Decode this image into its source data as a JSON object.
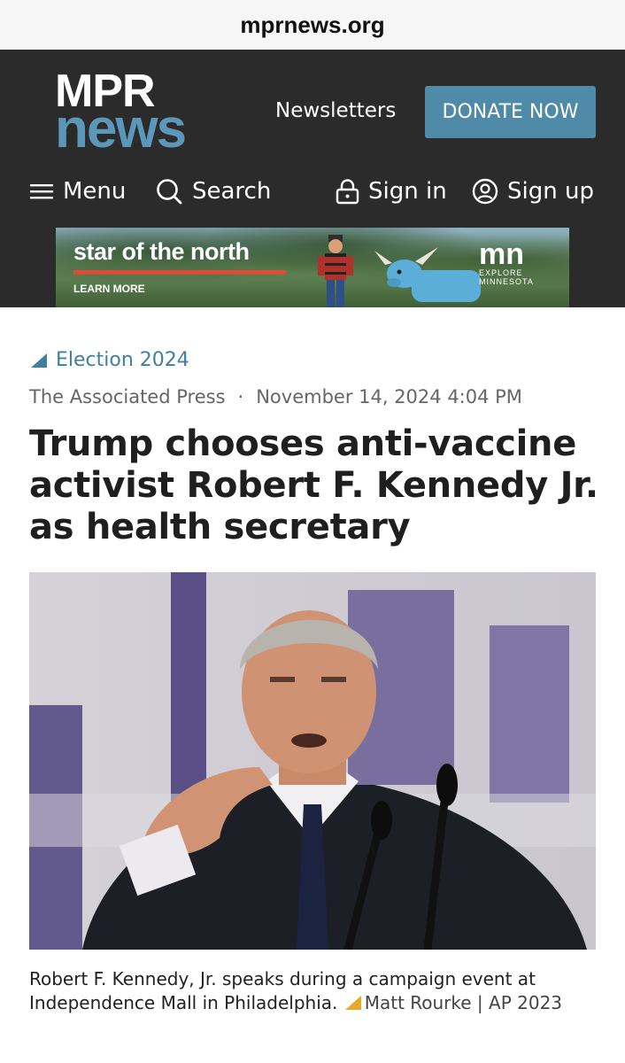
{
  "browser": {
    "url": "mprnews.org"
  },
  "header": {
    "logo_top": "MPR",
    "logo_bottom": "news",
    "newsletters_label": "Newsletters",
    "donate_label": "DONATE NOW",
    "nav": {
      "menu_label": "Menu",
      "search_label": "Search",
      "signin_label": "Sign in",
      "signup_label": "Sign up"
    }
  },
  "ad": {
    "headline": "star of the north",
    "cta": "LEARN MORE",
    "brand_mark": "mn",
    "brand_sub1": "EXPLORE",
    "brand_sub2": "MINNESOTA"
  },
  "article": {
    "category": "Election 2024",
    "author": "The Associated Press",
    "separator": "·",
    "date": "November 14, 2024 4:04 PM",
    "title": "Trump chooses anti-vaccine activist Robert F. Kennedy Jr. as health secretary",
    "caption_text": "Robert F. Kennedy, Jr. speaks during a campaign event at Independence Mall in Philadelphia.",
    "caption_credit": "Matt Rourke | AP 2023"
  },
  "colors": {
    "header_bg": "#2b2b2b",
    "brand_blue": "#5b97b8",
    "donate_bg": "#4f8aa8",
    "category_link": "#3f7fa0",
    "credit_triangle": "#e8a82a"
  },
  "icons": [
    "hamburger-icon",
    "search-icon",
    "lock-icon",
    "user-icon",
    "triangle-icon"
  ]
}
